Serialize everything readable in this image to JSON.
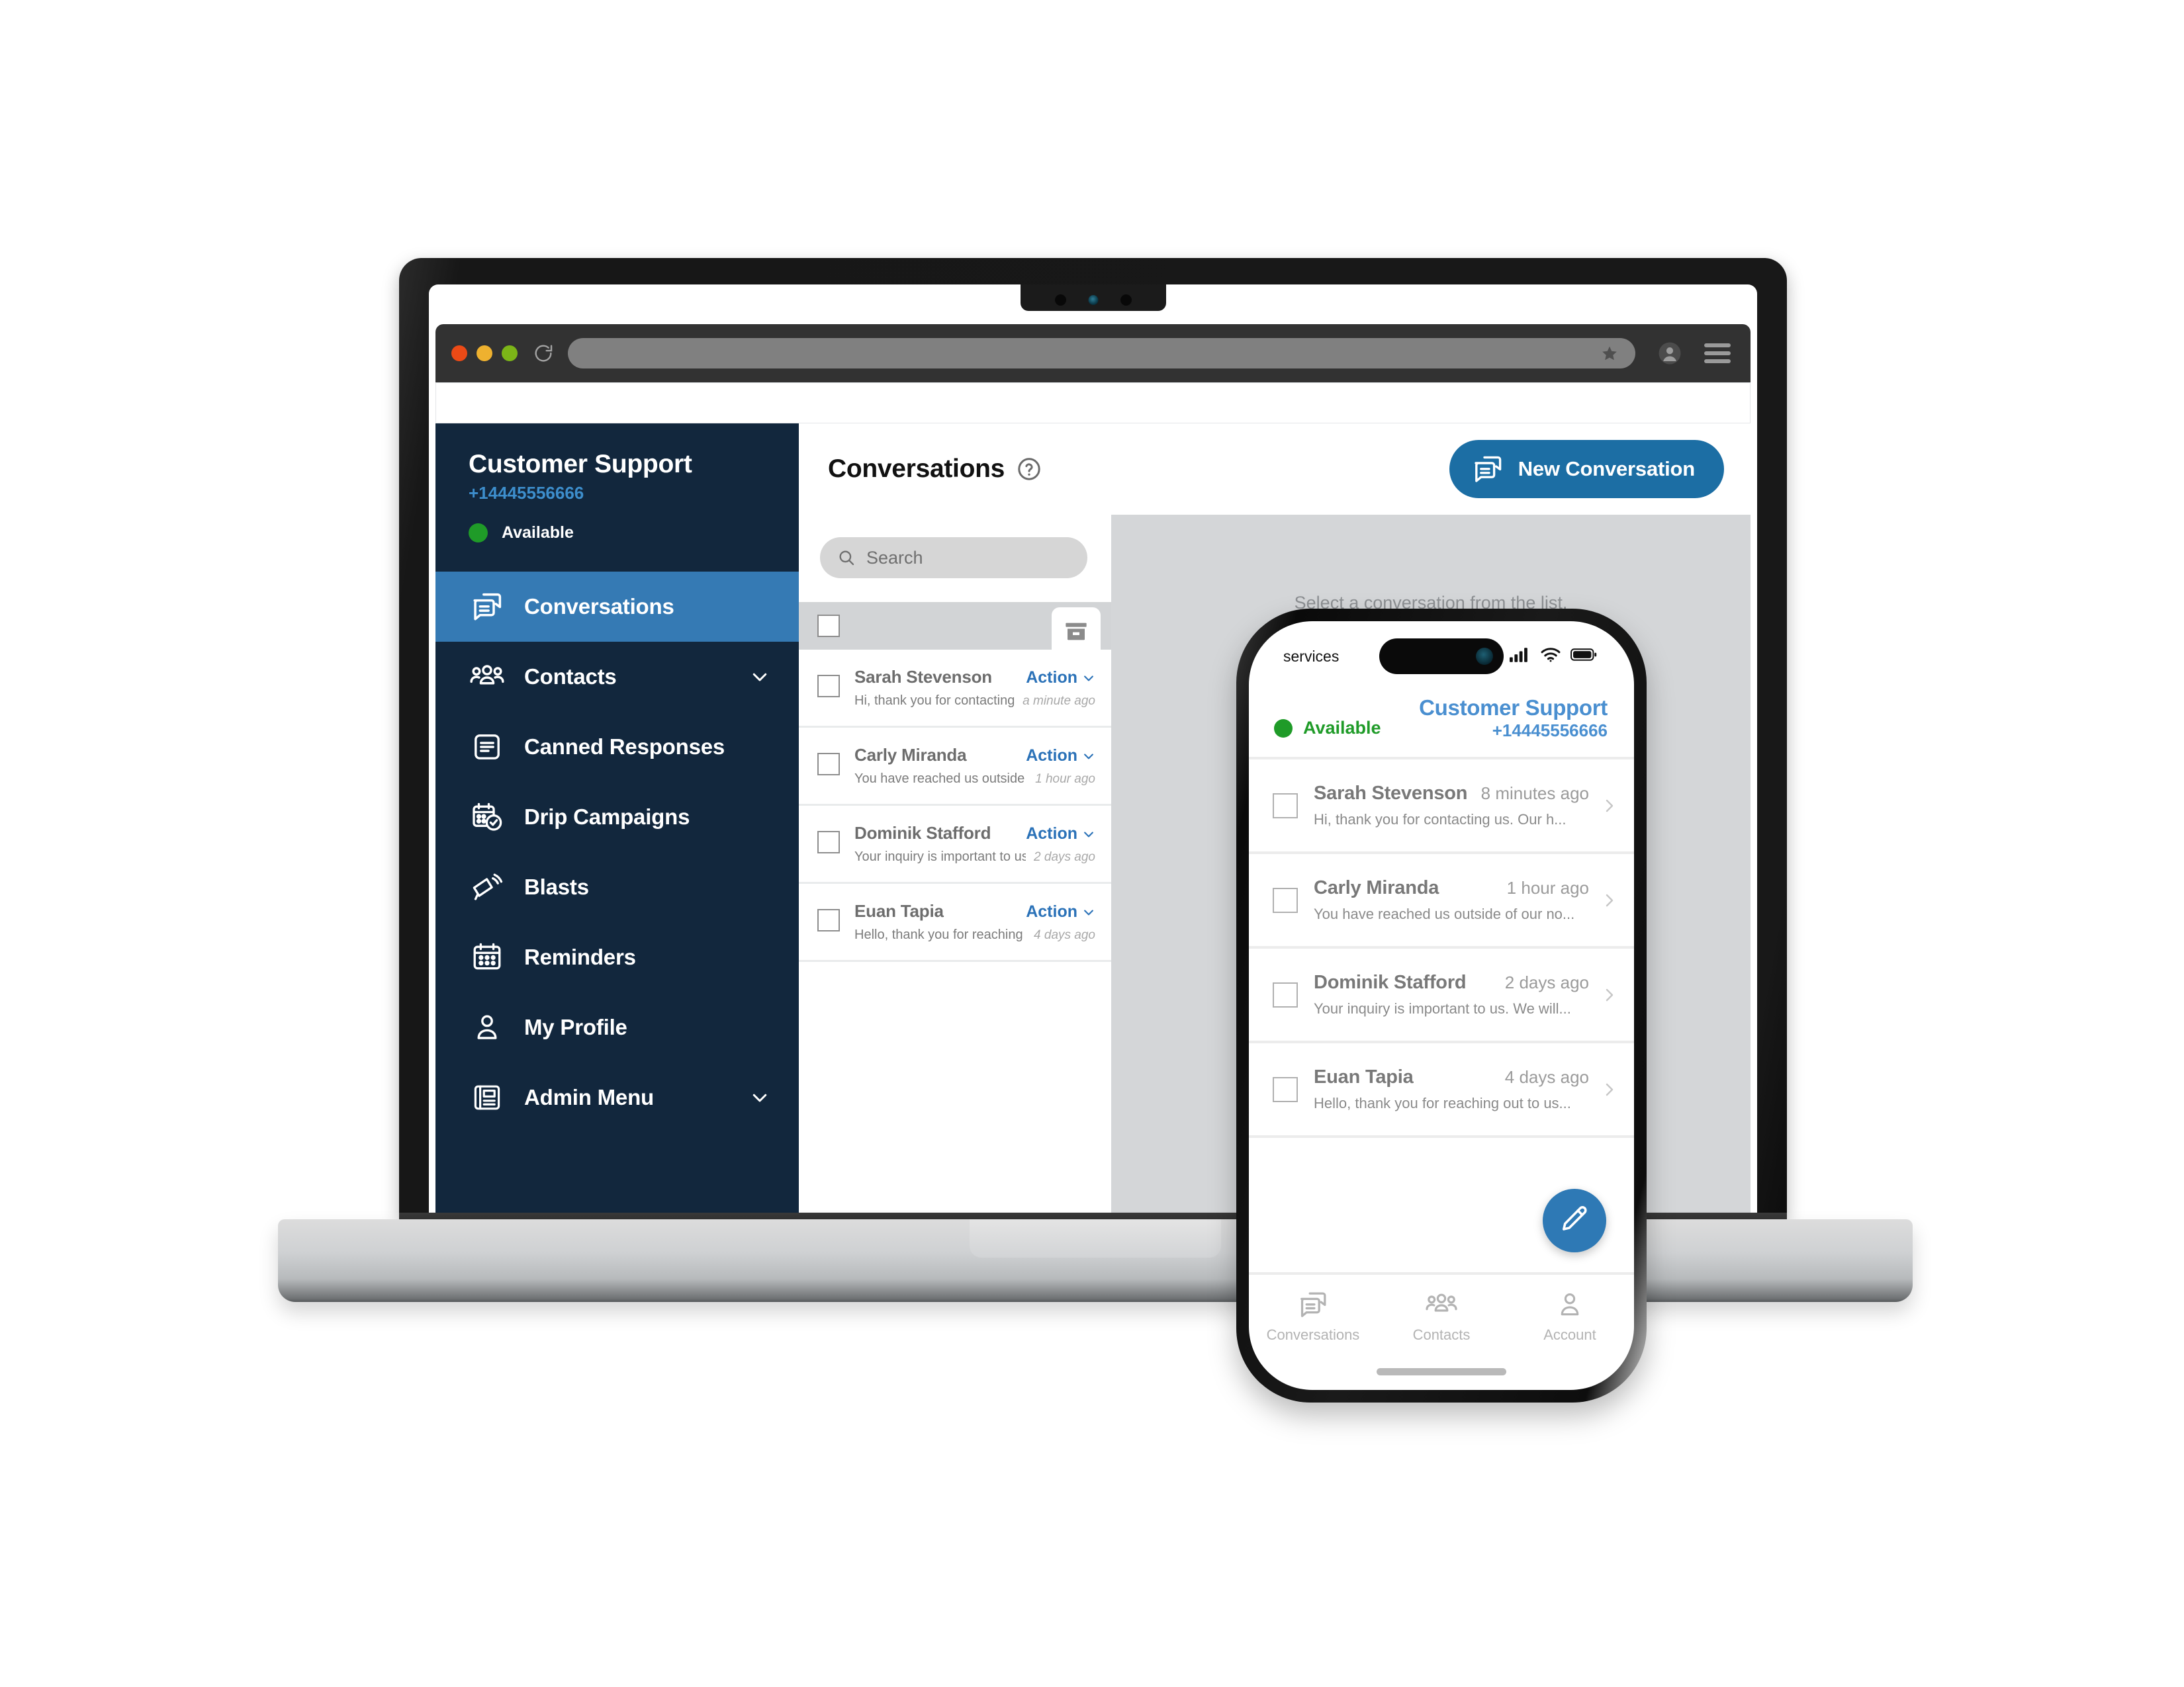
{
  "browser": {
    "traffic_lights": [
      "close-red",
      "minimize-yellow",
      "maximize-green"
    ],
    "reload_icon": "reload-icon",
    "url_value": "",
    "bookmark_icon": "star-icon",
    "profile_icon": "profile-avatar-icon",
    "menu_icon": "hamburger-menu-icon"
  },
  "sidebar": {
    "org_name": "Customer Support",
    "org_phone": "+14445556666",
    "presence_label": "Available",
    "presence_color": "#1f9b28",
    "active_color": "#357ab4",
    "background_color": "#12273d",
    "items": [
      {
        "label": "Conversations",
        "icon": "conversations-icon",
        "active": true,
        "expandable": false
      },
      {
        "label": "Contacts",
        "icon": "contacts-icon",
        "active": false,
        "expandable": true
      },
      {
        "label": "Canned Responses",
        "icon": "canned-responses-icon",
        "active": false,
        "expandable": false
      },
      {
        "label": "Drip Campaigns",
        "icon": "drip-campaigns-icon",
        "active": false,
        "expandable": false
      },
      {
        "label": "Blasts",
        "icon": "blasts-megaphone-icon",
        "active": false,
        "expandable": false
      },
      {
        "label": "Reminders",
        "icon": "reminders-calendar-icon",
        "active": false,
        "expandable": false
      },
      {
        "label": "My Profile",
        "icon": "my-profile-person-icon",
        "active": false,
        "expandable": false
      },
      {
        "label": "Admin Menu",
        "icon": "admin-menu-icon",
        "active": false,
        "expandable": true
      }
    ]
  },
  "main": {
    "page_title": "Conversations",
    "help_icon": "help-question-icon",
    "new_conversation_label": "New Conversation",
    "new_conversation_color": "#1c6ea4",
    "search_placeholder": "Search",
    "search_value": "",
    "archive_tab_icon": "archive-box-icon",
    "empty_state": "Select a conversation from the list.",
    "action_label": "Action",
    "conversations": [
      {
        "name": "Sarah Stevenson",
        "preview": "Hi, thank you for contacting us. Our h...",
        "time": "a minute ago"
      },
      {
        "name": "Carly Miranda",
        "preview": "You have reached us outside of our no...",
        "time": "1 hour ago"
      },
      {
        "name": "Dominik Stafford",
        "preview": "Your inquiry is important to us. We will...",
        "time": "2 days ago"
      },
      {
        "name": "Euan Tapia",
        "preview": "Hello, thank you for reaching out to us...",
        "time": "4 days ago"
      }
    ]
  },
  "phone": {
    "status": {
      "carrier": "services",
      "signal_icon": "cellular-signal-icon",
      "wifi_icon": "wifi-icon",
      "battery_icon": "battery-icon"
    },
    "presence_label": "Available",
    "org_name": "Customer Support",
    "org_phone": "+14445556666",
    "accent_color": "#4a8fd0",
    "fab_icon": "compose-pencil-icon",
    "fab_color": "#2e79b5",
    "conversations": [
      {
        "name": "Sarah Stevenson",
        "time": "8 minutes ago",
        "preview": "Hi, thank you for contacting us. Our h..."
      },
      {
        "name": "Carly Miranda",
        "time": "1 hour ago",
        "preview": "You have reached us outside of our no..."
      },
      {
        "name": "Dominik Stafford",
        "time": "2 days ago",
        "preview": "Your inquiry is important to us. We will..."
      },
      {
        "name": "Euan Tapia",
        "time": "4 days ago",
        "preview": "Hello, thank you for reaching out to us..."
      }
    ],
    "tabs": [
      {
        "label": "Conversations",
        "icon": "conversations-icon"
      },
      {
        "label": "Contacts",
        "icon": "contacts-icon"
      },
      {
        "label": "Account",
        "icon": "account-person-icon"
      }
    ]
  }
}
